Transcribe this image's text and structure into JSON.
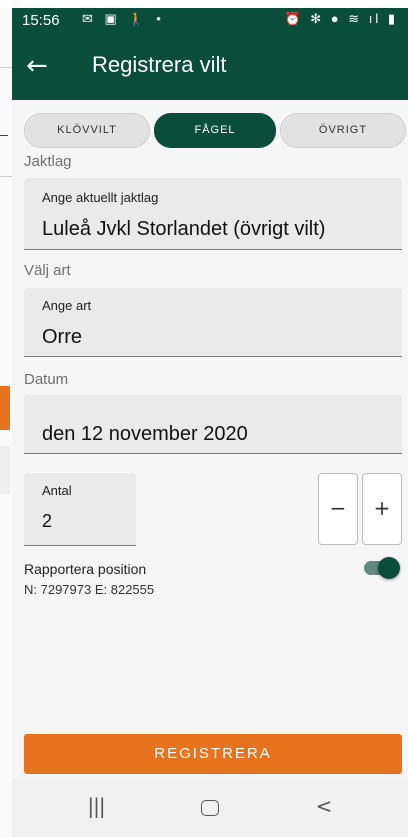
{
  "statusbar": {
    "time": "15:56",
    "left_icons": "✉ ▣ 🚶 •",
    "right_icons": "⏰ ✻ ● ≋ ıl ▮"
  },
  "appbar": {
    "back_glyph": "←",
    "title": "Registrera vilt"
  },
  "segments": [
    {
      "label": "KLÖVVILT",
      "active": false
    },
    {
      "label": "FÅGEL",
      "active": true
    },
    {
      "label": "ÖVRIGT",
      "active": false
    }
  ],
  "jaktlag": {
    "section_label": "Jaktlag",
    "field_label": "Ange aktuellt jaktlag",
    "value": "Luleå Jvkl Storlandet (övrigt vilt)"
  },
  "art": {
    "section_label": "Välj art",
    "field_label": "Ange art",
    "value": "Orre"
  },
  "datum": {
    "section_label": "Datum",
    "value": "den 12 november 2020"
  },
  "antal": {
    "label": "Antal",
    "value": "2",
    "minus": "−",
    "plus": "+"
  },
  "position": {
    "label": "Rapportera position",
    "coords": "N: 7297973  E: 822555",
    "enabled": true
  },
  "register_button": "REGISTRERA",
  "navbar": {
    "recent": "|||",
    "back": "<"
  },
  "colors": {
    "primary": "#0a4d3a",
    "accent": "#e8731e"
  }
}
